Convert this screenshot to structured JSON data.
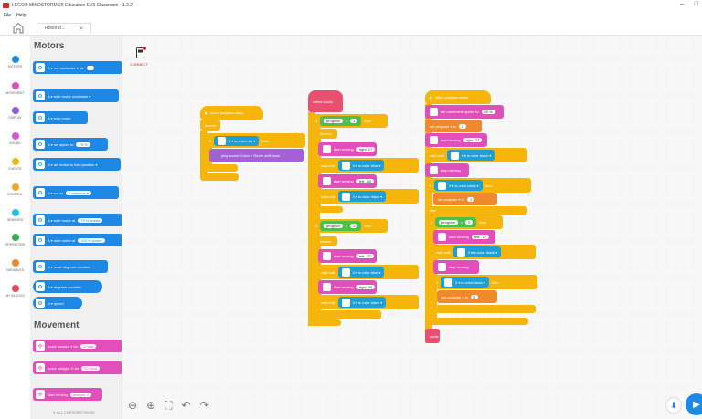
{
  "window": {
    "title": "LEGO® MINDSTORMS® Education EV3 Classroom - 1.2.2",
    "minimize": "–",
    "maximize": "□"
  },
  "menu": {
    "file": "File",
    "help": "Help"
  },
  "tab": {
    "name": "Robot cl...",
    "close": "✕"
  },
  "categories": [
    {
      "label": "MOTORS",
      "color": "#1e88e5"
    },
    {
      "label": "MOVEMENT",
      "color": "#e24fbb"
    },
    {
      "label": "DISPLAY",
      "color": "#8e5cd9"
    },
    {
      "label": "SOUND",
      "color": "#d655d6"
    },
    {
      "label": "EVENTS",
      "color": "#f5b50a"
    },
    {
      "label": "CONTROL",
      "color": "#f5a623"
    },
    {
      "label": "SENSORS",
      "color": "#1ec4e0"
    },
    {
      "label": "OPERATORS",
      "color": "#2fb04a"
    },
    {
      "label": "VARIABLES",
      "color": "#f0892b"
    },
    {
      "label": "MY BLOCKS",
      "color": "#e9445a"
    }
  ],
  "palette": {
    "motors_header": "Motors",
    "movement_header": "Movement",
    "blocks": [
      {
        "text": "A ▾  run  clockwise ▾  for",
        "pill": "1"
      },
      {
        "text": "A ▾  start motor  clockwise ▾",
        "pill": ""
      },
      {
        "text": "A ▾  stop motor",
        "pill": ""
      },
      {
        "text": "A ▾  set speed to",
        "pill": "75 %"
      },
      {
        "text": "A ▾  set motor to  hold position ▾",
        "pill": ""
      },
      {
        "text": "A ▾  run to",
        "pill": "0  rotations ▾"
      },
      {
        "text": "A ▾  start motor at",
        "pill": "75 % speed"
      },
      {
        "text": "A ▾  start motor at",
        "pill": "100 % power"
      },
      {
        "text": "A ▾  reset degrees counted",
        "pill": ""
      },
      {
        "text": "A ▾  degrees counted",
        "pill": ""
      },
      {
        "text": "A ▾  speed",
        "pill": ""
      }
    ],
    "movement_blocks": [
      {
        "text": "move  forward ▾  for",
        "pill": "1  rotat"
      },
      {
        "text": "move  straight: 0  for",
        "pill": "10  rotat"
      },
      {
        "text": "start moving",
        "pill": "straight: 0"
      }
    ],
    "all_cursors": "∨  ALL CURSORS SHOW"
  },
  "canvas": {
    "program_label": "CONNECT",
    "stack1": {
      "hat": "when program starts",
      "forever": "forever",
      "if": "if",
      "cond": "3 ▾  is color  red ▾",
      "then": "then",
      "sound": "play sound  Colors / Red ▾  until done"
    },
    "stack2": {
      "hat": "define  coots",
      "if1": "if",
      "var1": "program",
      "eq1": "=",
      "val1": "1",
      "then1": "then",
      "forever1": "forever",
      "move1": "start moving",
      "pill1": "right: 27",
      "wait1": "wait until",
      "sensor1": "3 ▾  is color  blue ▾",
      "move2": "start moving",
      "pill2": "left: -30",
      "wait2": "wait until",
      "sensor2": "3 ▾  is color  black ▾",
      "if2": "if",
      "var2": "program",
      "val2": "2",
      "then2": "then",
      "forever2": "forever",
      "move3": "start moving",
      "pill3": "left: -27",
      "wait3": "wait until",
      "sensor3": "3 ▾  is color  blue ▾",
      "move4": "start moving",
      "pill4": "right: 30",
      "wait4": "wait until",
      "sensor4": "3 ▾  is color  black ▾"
    },
    "stack3": {
      "hat": "when program starts",
      "setspeed": "set movement speed to",
      "speedval": "20  %",
      "set1": "set  program ▾  to",
      "set1val": "0",
      "move1": "start moving",
      "pill1": "right: 27",
      "wait1": "wait until",
      "sensor1": "3 ▾  is color  black ▾",
      "stop1": "stop moving",
      "if1": "if",
      "sensor2": "3 ▾  is color  black ▾",
      "then1": "then",
      "set2": "set  program ▾  to",
      "set2val": "1",
      "else": "else",
      "if2": "if",
      "var": "program",
      "eqval": "0",
      "then2": "then",
      "move2": "start moving",
      "pill2": "left: -27",
      "wait2": "wait until",
      "sensor3": "3 ▾  is color  black ▾",
      "stop2": "stop moving",
      "if3": "if",
      "sensor4": "3 ▾  is color  black ▾",
      "then3": "then",
      "set3": "set  program ▾  to",
      "set3val": "2",
      "coots": "coots"
    }
  },
  "tools": {
    "zoom_out": "⊖",
    "zoom_in": "⊕",
    "fit": "⛶",
    "undo": "↶",
    "redo": "↷",
    "download": "⬇",
    "run": "▶"
  }
}
